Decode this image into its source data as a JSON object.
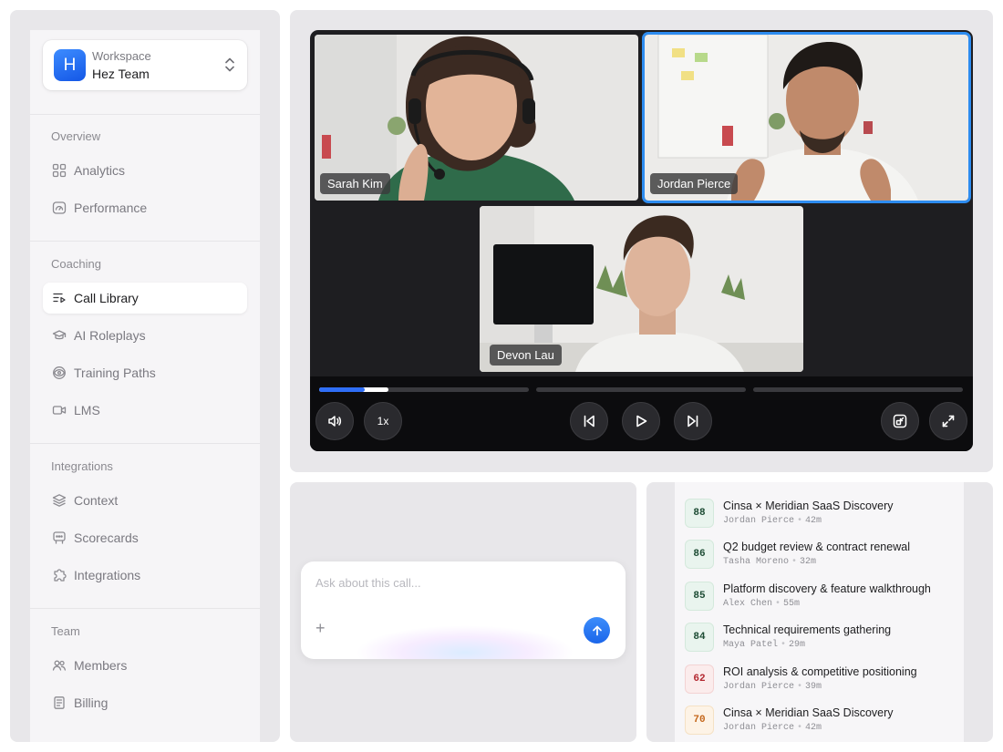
{
  "workspace": {
    "logo_letter": "H",
    "label": "Workspace",
    "name": "Hez Team"
  },
  "nav": {
    "overview": {
      "label": "Overview",
      "items": [
        {
          "label": "Analytics",
          "icon": "grid-icon"
        },
        {
          "label": "Performance",
          "icon": "gauge-icon"
        }
      ]
    },
    "coaching": {
      "label": "Coaching",
      "items": [
        {
          "label": "Call Library",
          "icon": "list-play-icon",
          "active": true
        },
        {
          "label": "AI Roleplays",
          "icon": "graduation-cap-icon"
        },
        {
          "label": "Training Paths",
          "icon": "target-icon"
        },
        {
          "label": "LMS",
          "icon": "video-camera-icon"
        }
      ]
    },
    "integrations": {
      "label": "Integrations",
      "items": [
        {
          "label": "Context",
          "icon": "layers-icon"
        },
        {
          "label": "Scorecards",
          "icon": "scorecard-icon"
        },
        {
          "label": "Integrations",
          "icon": "puzzle-icon"
        }
      ]
    },
    "team": {
      "label": "Team",
      "items": [
        {
          "label": "Members",
          "icon": "users-icon"
        },
        {
          "label": "Billing",
          "icon": "receipt-icon"
        }
      ]
    }
  },
  "video": {
    "participants": [
      {
        "name": "Sarah Kim"
      },
      {
        "name": "Jordan Pierce",
        "speaking": true
      },
      {
        "name": "Devon Lau"
      }
    ],
    "progress_fraction": 0.33,
    "speed_label": "1x",
    "accent_color": "#2d8cf0"
  },
  "chat": {
    "placeholder": "Ask about this call...",
    "plus": "+"
  },
  "calls": [
    {
      "score": "88",
      "status": "good",
      "title": "Cinsa × Meridian SaaS Discovery",
      "rep": "Jordan Pierce",
      "duration": "42m"
    },
    {
      "score": "86",
      "status": "good",
      "title": "Q2 budget review & contract renewal",
      "rep": "Tasha Moreno",
      "duration": "32m"
    },
    {
      "score": "85",
      "status": "good",
      "title": "Platform discovery & feature walkthrough",
      "rep": "Alex Chen",
      "duration": "55m"
    },
    {
      "score": "84",
      "status": "good",
      "title": "Technical requirements gathering",
      "rep": "Maya Patel",
      "duration": "29m"
    },
    {
      "score": "62",
      "status": "bad",
      "title": "ROI analysis & competitive positioning",
      "rep": "Jordan Pierce",
      "duration": "39m"
    },
    {
      "score": "70",
      "status": "warn",
      "title": "Cinsa × Meridian SaaS Discovery",
      "rep": "Jordan Pierce",
      "duration": "42m"
    }
  ]
}
